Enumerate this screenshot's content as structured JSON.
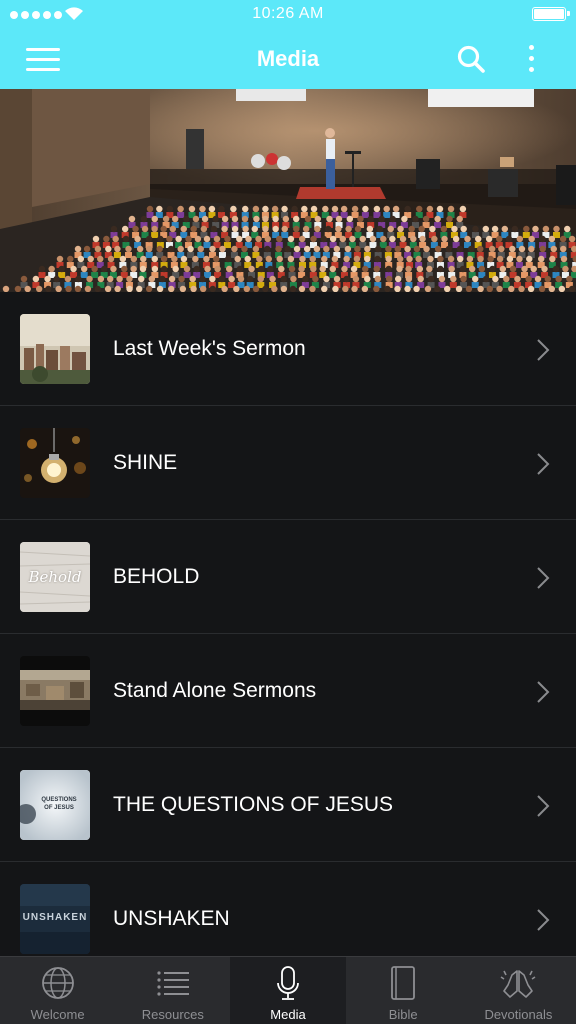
{
  "status_bar": {
    "time": "10:26 AM"
  },
  "nav": {
    "title": "Media"
  },
  "colors": {
    "accent": "#5ce8f9",
    "background": "#141517",
    "tab_bar": "#2a2b2e"
  },
  "hero": {
    "icon": "church-stage-photo"
  },
  "media_list": [
    {
      "label": "Last Week's Sermon",
      "thumb": "city-thumbnail"
    },
    {
      "label": "SHINE",
      "thumb": "lightbulb-thumbnail"
    },
    {
      "label": "BEHOLD",
      "thumb": "behold-thumbnail",
      "thumb_text": "Behold"
    },
    {
      "label": "Stand Alone Sermons",
      "thumb": "aerial-city-thumbnail"
    },
    {
      "label": "THE QUESTIONS OF JESUS",
      "thumb": "questions-thumbnail",
      "thumb_text": "QUESTIONS OF JESUS"
    },
    {
      "label": "UNSHAKEN",
      "thumb": "unshaken-thumbnail",
      "thumb_text": "UNSHAKEN"
    }
  ],
  "tabs": [
    {
      "label": "Welcome",
      "icon": "globe-icon",
      "active": false
    },
    {
      "label": "Resources",
      "icon": "list-icon",
      "active": false
    },
    {
      "label": "Media",
      "icon": "microphone-icon",
      "active": true
    },
    {
      "label": "Bible",
      "icon": "book-icon",
      "active": false
    },
    {
      "label": "Devotionals",
      "icon": "praying-hands-icon",
      "active": false
    }
  ]
}
